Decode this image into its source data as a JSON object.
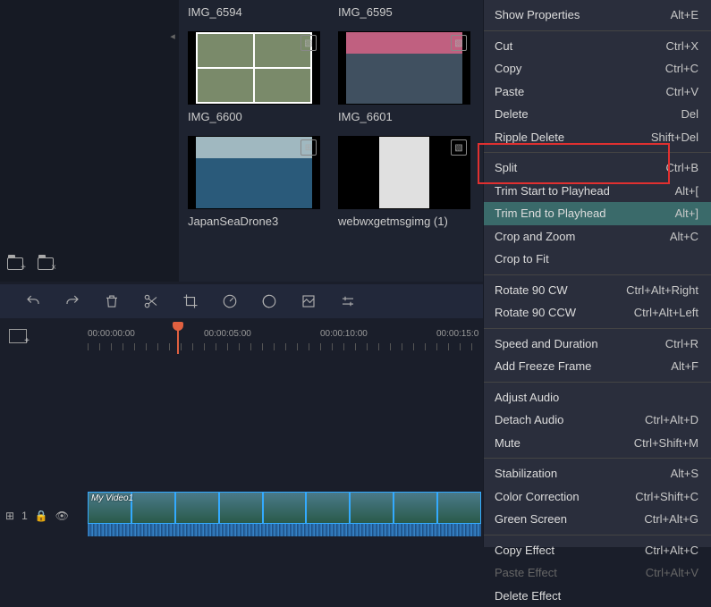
{
  "media": [
    {
      "label": "IMG_6594",
      "type": "image"
    },
    {
      "label": "IMG_6595",
      "type": "image"
    },
    {
      "label": "IMG_6600",
      "type": "image"
    },
    {
      "label": "IMG_6601",
      "type": "image"
    },
    {
      "label": "JapanSeaDrone3",
      "type": "video"
    },
    {
      "label": "webwxgetmsgimg (1)",
      "type": "image"
    }
  ],
  "ruler": {
    "t0": "00:00:00:00",
    "t1": "00:00:05:00",
    "t2": "00:00:10:00",
    "t3": "00:00:15:0"
  },
  "track": {
    "number": "1",
    "clip_label": "My Video1"
  },
  "menu": {
    "groups": [
      [
        {
          "label": "Show Properties",
          "shortcut": "Alt+E"
        }
      ],
      [
        {
          "label": "Cut",
          "shortcut": "Ctrl+X"
        },
        {
          "label": "Copy",
          "shortcut": "Ctrl+C"
        },
        {
          "label": "Paste",
          "shortcut": "Ctrl+V"
        },
        {
          "label": "Delete",
          "shortcut": "Del"
        },
        {
          "label": "Ripple Delete",
          "shortcut": "Shift+Del"
        }
      ],
      [
        {
          "label": "Split",
          "shortcut": "Ctrl+B"
        },
        {
          "label": "Trim Start to Playhead",
          "shortcut": "Alt+[",
          "highlight": false
        },
        {
          "label": "Trim End to Playhead",
          "shortcut": "Alt+]",
          "highlight": true
        },
        {
          "label": "Crop and Zoom",
          "shortcut": "Alt+C"
        },
        {
          "label": "Crop to Fit",
          "shortcut": ""
        }
      ],
      [
        {
          "label": "Rotate 90 CW",
          "shortcut": "Ctrl+Alt+Right"
        },
        {
          "label": "Rotate 90 CCW",
          "shortcut": "Ctrl+Alt+Left"
        }
      ],
      [
        {
          "label": "Speed and Duration",
          "shortcut": "Ctrl+R"
        },
        {
          "label": "Add Freeze Frame",
          "shortcut": "Alt+F"
        }
      ],
      [
        {
          "label": "Adjust Audio",
          "shortcut": ""
        },
        {
          "label": "Detach Audio",
          "shortcut": "Ctrl+Alt+D"
        },
        {
          "label": "Mute",
          "shortcut": "Ctrl+Shift+M"
        }
      ],
      [
        {
          "label": "Stabilization",
          "shortcut": "Alt+S"
        },
        {
          "label": "Color Correction",
          "shortcut": "Ctrl+Shift+C"
        },
        {
          "label": "Green Screen",
          "shortcut": "Ctrl+Alt+G"
        }
      ],
      [
        {
          "label": "Copy Effect",
          "shortcut": "Ctrl+Alt+C"
        },
        {
          "label": "Paste Effect",
          "shortcut": "Ctrl+Alt+V",
          "disabled": true
        },
        {
          "label": "Delete Effect",
          "shortcut": ""
        }
      ]
    ]
  }
}
